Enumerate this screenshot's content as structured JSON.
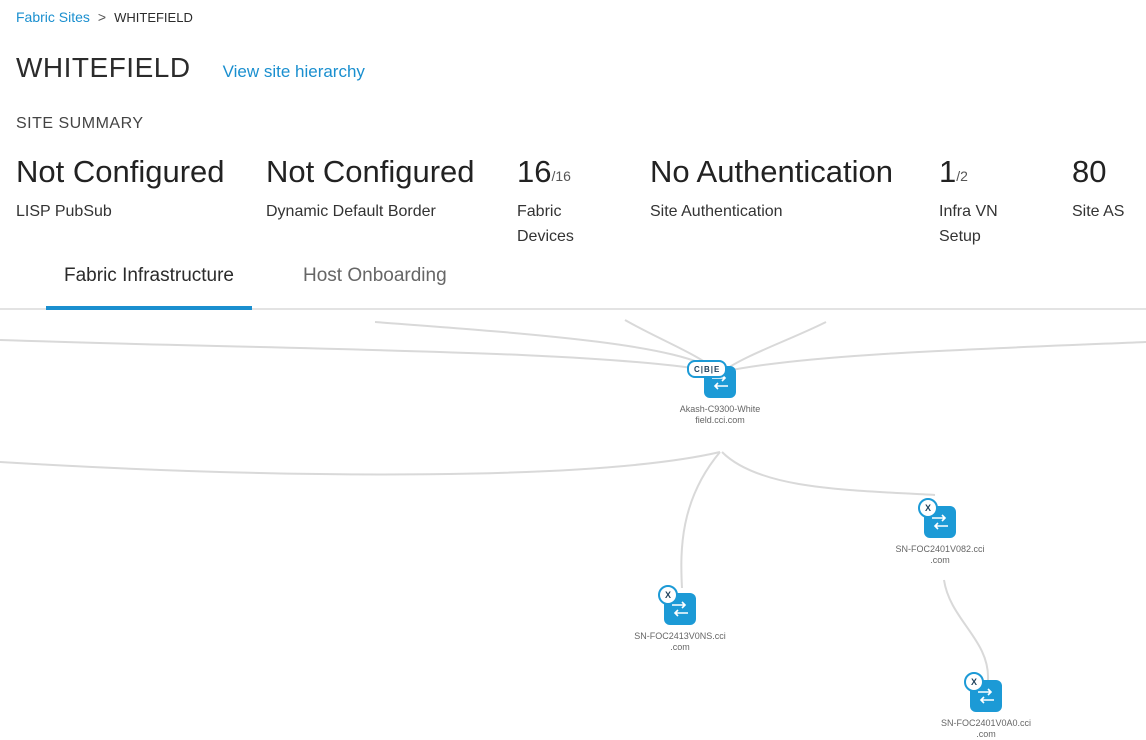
{
  "breadcrumb": {
    "parent": "Fabric Sites",
    "separator": ">",
    "current": "WHITEFIELD"
  },
  "header": {
    "title": "WHITEFIELD",
    "hierarchy_link": "View site hierarchy"
  },
  "summary": {
    "heading": "SITE SUMMARY",
    "stats": [
      {
        "value": "Not Configured",
        "label": "LISP PubSub"
      },
      {
        "value": "Not Configured",
        "label": "Dynamic Default Border"
      },
      {
        "value": "16",
        "total": "/16",
        "label_line1": "Fabric",
        "label_line2": "Devices"
      },
      {
        "value": "No Authentication",
        "label": "Site Authentication"
      },
      {
        "value": "1",
        "total": "/2",
        "label_line1": "Infra VN",
        "label_line2": "Setup"
      },
      {
        "value": "80",
        "label": "Site AS"
      }
    ]
  },
  "tabs": [
    {
      "label": "Fabric Infrastructure",
      "active": true
    },
    {
      "label": "Host Onboarding",
      "active": false
    }
  ],
  "topology": {
    "nodes": [
      {
        "name_line1": "Akash-C9300-White",
        "name_line2": "field.cci.com",
        "badge": "C|B|E",
        "icon": "switch-icon"
      },
      {
        "name_line1": "SN-FOC2401V082.cci",
        "name_line2": ".com",
        "badge": "X",
        "icon": "switch-icon"
      },
      {
        "name_line1": "SN-FOC2413V0NS.cci",
        "name_line2": ".com",
        "badge": "X",
        "icon": "switch-icon"
      },
      {
        "name_line1": "SN-FOC2401V0A0.cci",
        "name_line2": ".com",
        "badge": "X",
        "icon": "switch-icon"
      }
    ]
  },
  "colors": {
    "accent": "#1a8fcf",
    "device": "#1c9ad6",
    "link": "#d9d9d9"
  }
}
